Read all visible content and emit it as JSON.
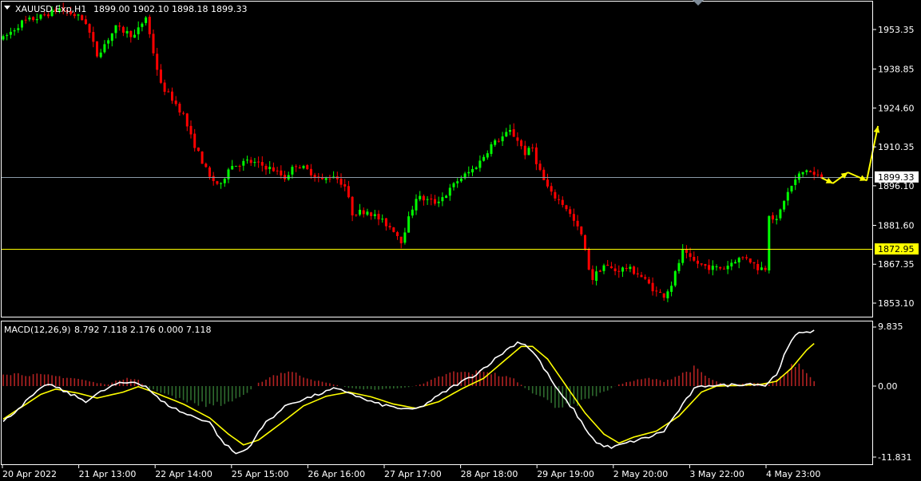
{
  "header": {
    "symbol": "XAUUSD.Exp,H1",
    "ohlc": "1899.00 1902.10 1898.18 1899.33"
  },
  "macd_header": {
    "label": "MACD(12,26,9)",
    "values": "8.792 7.118 2.176 0.000 7.118"
  },
  "colors": {
    "background": "#000000",
    "bull": "#00ff00",
    "bear": "#ff0000",
    "hline_current": "#8a9aa8",
    "hline_level": "#ffff00",
    "macd_line": "#ffffff",
    "signal_line": "#ffff00",
    "hist_pos": "#b22222",
    "hist_neg": "#2e6b2e",
    "arrows": "#ffff00"
  },
  "chart_data": [
    {
      "type": "candlestick",
      "title": "XAUUSD.Exp,H1",
      "ylim": [
        1846,
        1966
      ],
      "yticks": [
        "1953.35",
        "1938.85",
        "1924.60",
        "1910.35",
        "1896.10",
        "1881.60",
        "1867.35",
        "1853.10"
      ],
      "price_labels": [
        {
          "name": "current-price",
          "value": 1899.33,
          "text": "1899.33"
        },
        {
          "name": "level-line",
          "value": 1872.95,
          "text": "1872.95"
        }
      ],
      "x_labels": [
        "20 Apr 2022",
        "21 Apr 13:00",
        "22 Apr 14:00",
        "25 Apr 15:00",
        "26 Apr 16:00",
        "27 Apr 17:00",
        "28 Apr 18:00",
        "29 Apr 19:00",
        "2 May 20:00",
        "3 May 22:00",
        "4 May 23:00"
      ],
      "path_close": [
        [
          0,
          1950
        ],
        [
          5,
          1956
        ],
        [
          10,
          1958
        ],
        [
          15,
          1961
        ],
        [
          20,
          1958
        ],
        [
          22,
          1956
        ],
        [
          25,
          1944
        ],
        [
          28,
          1950
        ],
        [
          30,
          1954
        ],
        [
          35,
          1951
        ],
        [
          38,
          1958
        ],
        [
          40,
          1945
        ],
        [
          42,
          1933
        ],
        [
          45,
          1928
        ],
        [
          48,
          1922
        ],
        [
          50,
          1914
        ],
        [
          55,
          1899
        ],
        [
          58,
          1896
        ],
        [
          60,
          1903
        ],
        [
          65,
          1905
        ],
        [
          68,
          1904
        ],
        [
          72,
          1902
        ],
        [
          75,
          1899
        ],
        [
          78,
          1904
        ],
        [
          82,
          1901
        ],
        [
          85,
          1898
        ],
        [
          88,
          1900
        ],
        [
          91,
          1896
        ],
        [
          93,
          1886
        ],
        [
          97,
          1887
        ],
        [
          100,
          1884
        ],
        [
          104,
          1880
        ],
        [
          106,
          1876
        ],
        [
          108,
          1884
        ],
        [
          110,
          1892
        ],
        [
          115,
          1890
        ],
        [
          118,
          1893
        ],
        [
          121,
          1898
        ],
        [
          125,
          1902
        ],
        [
          127,
          1905
        ],
        [
          130,
          1911
        ],
        [
          133,
          1914
        ],
        [
          135,
          1916
        ],
        [
          137,
          1913
        ],
        [
          139,
          1908
        ],
        [
          141,
          1910
        ],
        [
          142,
          1905
        ],
        [
          144,
          1898
        ],
        [
          146,
          1893
        ],
        [
          148,
          1891
        ],
        [
          150,
          1888
        ],
        [
          152,
          1883
        ],
        [
          154,
          1878
        ],
        [
          156,
          1866
        ],
        [
          157,
          1862
        ],
        [
          158,
          1864
        ],
        [
          160,
          1867
        ],
        [
          163,
          1865
        ],
        [
          166,
          1866
        ],
        [
          169,
          1864
        ],
        [
          172,
          1860
        ],
        [
          174,
          1857
        ],
        [
          176,
          1856
        ],
        [
          178,
          1860
        ],
        [
          180,
          1868
        ],
        [
          181,
          1872
        ],
        [
          183,
          1869
        ],
        [
          186,
          1867
        ],
        [
          189,
          1866
        ],
        [
          192,
          1866
        ],
        [
          195,
          1869
        ],
        [
          198,
          1870
        ],
        [
          201,
          1866
        ],
        [
          203,
          1866
        ],
        [
          204,
          1886
        ],
        [
          206,
          1883
        ],
        [
          208,
          1891
        ],
        [
          210,
          1896
        ],
        [
          212,
          1900
        ],
        [
          214,
          1902
        ],
        [
          216,
          1900
        ],
        [
          218,
          1899
        ]
      ],
      "forecast_arrows": [
        [
          218,
          1899
        ],
        [
          221,
          1897
        ],
        [
          225,
          1901
        ],
        [
          230,
          1898
        ],
        [
          233,
          1918
        ]
      ]
    },
    {
      "type": "macd",
      "title": "MACD(12,26,9)",
      "ylim": [
        -12.5,
        10.6
      ],
      "yticks": [
        "9.835",
        "0.00",
        "-11.831"
      ],
      "macd_line": [
        [
          0,
          -6
        ],
        [
          8,
          -1.5
        ],
        [
          12,
          0.4
        ],
        [
          16,
          -0.8
        ],
        [
          22,
          -2.5
        ],
        [
          26,
          -1
        ],
        [
          30,
          0.3
        ],
        [
          35,
          0.7
        ],
        [
          38,
          0
        ],
        [
          42,
          -2.5
        ],
        [
          48,
          -4.5
        ],
        [
          55,
          -6
        ],
        [
          58,
          -9
        ],
        [
          62,
          -11.3
        ],
        [
          65,
          -10.5
        ],
        [
          70,
          -6
        ],
        [
          76,
          -3
        ],
        [
          82,
          -1.8
        ],
        [
          88,
          -0.5
        ],
        [
          92,
          -1
        ],
        [
          96,
          -2.2
        ],
        [
          100,
          -3
        ],
        [
          104,
          -3.5
        ],
        [
          108,
          -4
        ],
        [
          111,
          -3.6
        ],
        [
          115,
          -2
        ],
        [
          120,
          0
        ],
        [
          126,
          2
        ],
        [
          130,
          4
        ],
        [
          134,
          6
        ],
        [
          137,
          7.3
        ],
        [
          139,
          7
        ],
        [
          142,
          5
        ],
        [
          145,
          2
        ],
        [
          148,
          -1
        ],
        [
          152,
          -4
        ],
        [
          155,
          -7
        ],
        [
          158,
          -9.5
        ],
        [
          162,
          -10.3
        ],
        [
          166,
          -9.5
        ],
        [
          172,
          -8.5
        ],
        [
          176,
          -7.5
        ],
        [
          180,
          -4
        ],
        [
          184,
          -0.5
        ],
        [
          188,
          0.2
        ],
        [
          192,
          0.1
        ],
        [
          196,
          0.3
        ],
        [
          200,
          0.4
        ],
        [
          203,
          0.1
        ],
        [
          206,
          2
        ],
        [
          208,
          5
        ],
        [
          210,
          7.5
        ],
        [
          212,
          9
        ],
        [
          216,
          9.2
        ]
      ],
      "signal_line": [
        [
          0,
          -5.5
        ],
        [
          10,
          -1.4
        ],
        [
          14,
          -0.5
        ],
        [
          20,
          -1.2
        ],
        [
          25,
          -2
        ],
        [
          32,
          -1
        ],
        [
          36,
          -0.1
        ],
        [
          40,
          -1
        ],
        [
          48,
          -3
        ],
        [
          55,
          -5.3
        ],
        [
          60,
          -8
        ],
        [
          64,
          -9.8
        ],
        [
          68,
          -9
        ],
        [
          74,
          -6.2
        ],
        [
          80,
          -3.3
        ],
        [
          86,
          -1.7
        ],
        [
          92,
          -1
        ],
        [
          98,
          -1.8
        ],
        [
          104,
          -3
        ],
        [
          110,
          -3.7
        ],
        [
          116,
          -2.6
        ],
        [
          122,
          -0.5
        ],
        [
          128,
          1.3
        ],
        [
          134,
          4.5
        ],
        [
          138,
          6.6
        ],
        [
          141,
          6.6
        ],
        [
          145,
          4.5
        ],
        [
          150,
          0
        ],
        [
          155,
          -4.5
        ],
        [
          160,
          -8
        ],
        [
          164,
          -9.5
        ],
        [
          168,
          -8.5
        ],
        [
          174,
          -7.5
        ],
        [
          180,
          -5
        ],
        [
          186,
          -1
        ],
        [
          190,
          0
        ],
        [
          196,
          0.1
        ],
        [
          202,
          0.3
        ],
        [
          206,
          0.8
        ],
        [
          210,
          3
        ],
        [
          214,
          6
        ],
        [
          216,
          7.1
        ]
      ],
      "histogram": [
        [
          0,
          2.2
        ],
        [
          5,
          2
        ],
        [
          10,
          1.8
        ],
        [
          15,
          1.6
        ],
        [
          20,
          1.2
        ],
        [
          25,
          0.5
        ],
        [
          28,
          0.3
        ],
        [
          30,
          0.8
        ],
        [
          33,
          1.5
        ],
        [
          36,
          1
        ],
        [
          38,
          -0.3
        ],
        [
          42,
          -1
        ],
        [
          48,
          -2.5
        ],
        [
          55,
          -3.2
        ],
        [
          60,
          -2.8
        ],
        [
          64,
          -1.5
        ],
        [
          68,
          0.5
        ],
        [
          72,
          1.8
        ],
        [
          76,
          2.5
        ],
        [
          80,
          1.6
        ],
        [
          84,
          0.8
        ],
        [
          88,
          0.3
        ],
        [
          92,
          -0.3
        ],
        [
          98,
          -0.6
        ],
        [
          104,
          -0.4
        ],
        [
          108,
          -0.2
        ],
        [
          112,
          0.4
        ],
        [
          116,
          1.5
        ],
        [
          120,
          2.3
        ],
        [
          125,
          2.2
        ],
        [
          128,
          2.6
        ],
        [
          132,
          1.8
        ],
        [
          136,
          1.2
        ],
        [
          140,
          -0.8
        ],
        [
          144,
          -2.2
        ],
        [
          148,
          -3.5
        ],
        [
          152,
          -3.2
        ],
        [
          156,
          -2
        ],
        [
          160,
          -1
        ],
        [
          164,
          0.3
        ],
        [
          168,
          0.9
        ],
        [
          172,
          1.3
        ],
        [
          176,
          0.8
        ],
        [
          180,
          1.8
        ],
        [
          184,
          3
        ],
        [
          188,
          1.3
        ],
        [
          192,
          0.2
        ],
        [
          196,
          0.3
        ],
        [
          200,
          0.6
        ],
        [
          204,
          0.3
        ],
        [
          206,
          1.2
        ],
        [
          208,
          2
        ],
        [
          210,
          3.5
        ],
        [
          212,
          3.8
        ],
        [
          214,
          2.5
        ],
        [
          216,
          0.8
        ]
      ]
    }
  ]
}
